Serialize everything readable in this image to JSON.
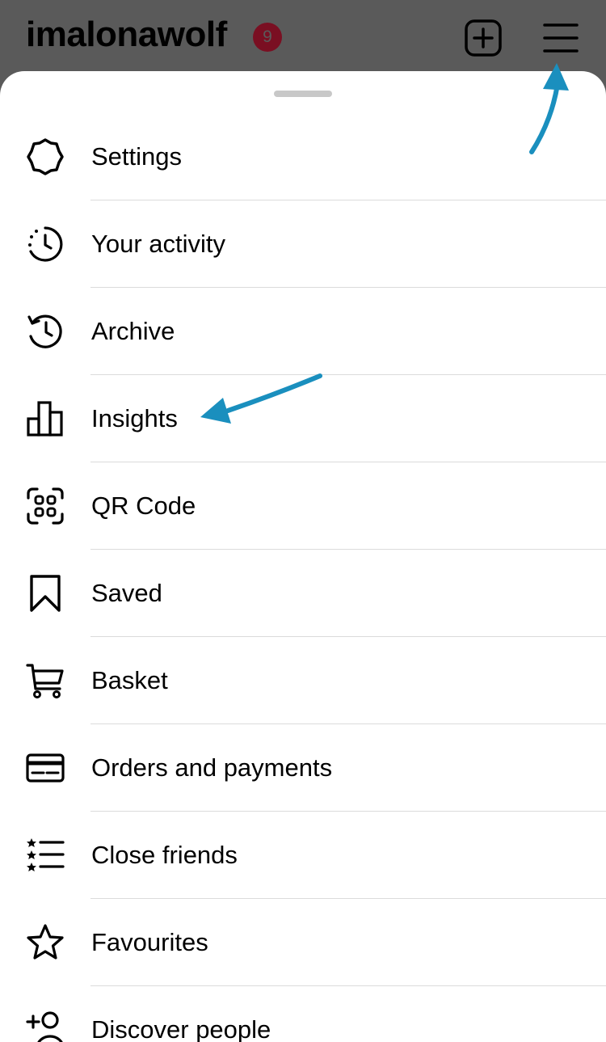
{
  "header": {
    "username": "imalonawolf",
    "notification_count": "9"
  },
  "menu": {
    "items": [
      {
        "label": "Settings",
        "icon": "settings-icon"
      },
      {
        "label": "Your activity",
        "icon": "activity-icon"
      },
      {
        "label": "Archive",
        "icon": "archive-icon"
      },
      {
        "label": "Insights",
        "icon": "insights-icon"
      },
      {
        "label": "QR Code",
        "icon": "qr-code-icon"
      },
      {
        "label": "Saved",
        "icon": "bookmark-icon"
      },
      {
        "label": "Basket",
        "icon": "cart-icon"
      },
      {
        "label": "Orders and payments",
        "icon": "credit-card-icon"
      },
      {
        "label": "Close friends",
        "icon": "star-list-icon"
      },
      {
        "label": "Favourites",
        "icon": "star-icon"
      },
      {
        "label": "Discover people",
        "icon": "add-person-icon"
      }
    ]
  },
  "colors": {
    "annotation_arrow": "#1a8fbe",
    "badge": "#7a0f22",
    "overlay": "#5a5a5a"
  }
}
